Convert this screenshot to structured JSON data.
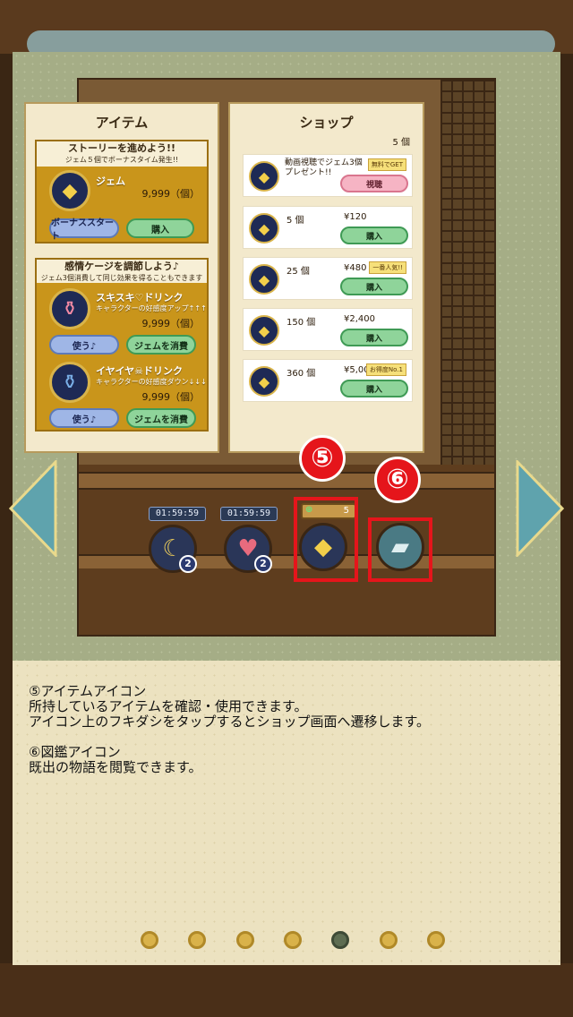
{
  "item_window": {
    "title": "アイテム",
    "gem_box": {
      "head_line1": "ストーリーを進めよう!!",
      "head_line2": "ジェム５個でボーナスタイム発生!!",
      "icon": "gem-icon",
      "name": "ジェム",
      "count": "9,999（個）",
      "bonus_button": "ボーナススタート",
      "buy_button": "購入"
    },
    "emotion_box": {
      "head_line1": "感情ケージを調節しよう♪",
      "head_line2": "ジェム3個消費して同じ効果を得ることもできます",
      "drinks": [
        {
          "icon": "pink-potion-icon",
          "name": "スキスキ♡ドリンク",
          "desc": "キャラクターの好感度アップ↑↑↑",
          "count": "9,999（個）",
          "use_button": "使う♪",
          "gem_button": "ジェムを消費"
        },
        {
          "icon": "blue-potion-icon",
          "name": "イヤイヤ☠ドリンク",
          "desc": "キャラクターの好感度ダウン↓↓↓",
          "count": "9,999（個）",
          "use_button": "使う♪",
          "gem_button": "ジェムを消費"
        }
      ]
    }
  },
  "shop_window": {
    "title": "ショップ",
    "owned": "5 個",
    "video_row": {
      "text": "動画視聴でジェム3個プレゼント!!",
      "tag": "無料でGET",
      "button": "視聴"
    },
    "rows": [
      {
        "qty": "5 個",
        "price": "¥120",
        "tag": "",
        "button": "購入"
      },
      {
        "qty": "25 個",
        "price": "¥480",
        "tag": "一番人気!!",
        "button": "購入"
      },
      {
        "qty": "150 個",
        "price": "¥2,400",
        "tag": "",
        "button": "購入"
      },
      {
        "qty": "360 個",
        "price": "¥5,000",
        "tag": "お得度No.1",
        "button": "購入"
      }
    ]
  },
  "hud": {
    "timer1": "01:59:59",
    "timer2": "01:59:59",
    "badge1": "2",
    "badge2": "2",
    "bubble_count": "5",
    "marker5": "⑤",
    "marker6": "⑥"
  },
  "description": {
    "heading5": "⑤アイテムアイコン",
    "line5a": "所持しているアイテムを確認・使用できます。",
    "line5b": "アイコン上のフキダシをタップするとショップ画面へ遷移します。",
    "heading6": "⑥図鑑アイコン",
    "line6a": "既出の物語を閲覧できます。"
  },
  "pagination": {
    "total": 7,
    "active_index": 4
  },
  "colors": {
    "highlight": "#e5151b",
    "panel": "#a5ad86",
    "arrow": "#5fa3ad"
  }
}
